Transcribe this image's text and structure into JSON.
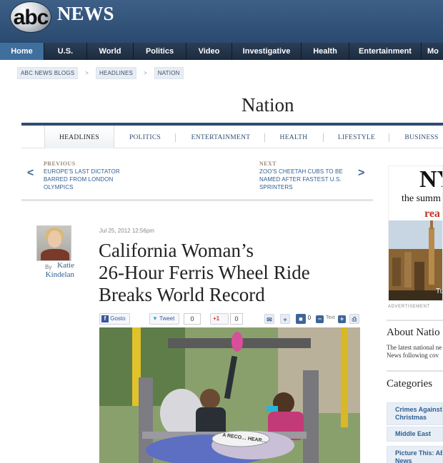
{
  "header": {
    "logo_abc": "abc",
    "logo_news": "NEWS"
  },
  "nav": [
    {
      "label": "Home",
      "active": true
    },
    {
      "label": "U.S."
    },
    {
      "label": "World"
    },
    {
      "label": "Politics"
    },
    {
      "label": "Video"
    },
    {
      "label": "Investigative"
    },
    {
      "label": "Health"
    },
    {
      "label": "Entertainment"
    },
    {
      "label": "Mo"
    }
  ],
  "breadcrumb": [
    "ABC NEWS BLOGS",
    "HEADLINES",
    "NATION"
  ],
  "breadcrumb_sep": ">",
  "section_title": "Nation",
  "section_tabs": [
    "HEADLINES",
    "POLITICS",
    "ENTERTAINMENT",
    "HEALTH",
    "LIFESTYLE",
    "BUSINESS"
  ],
  "prev": {
    "arrow": "<",
    "label": "PREVIOUS",
    "lines": [
      "EUROPE'S LAST DICTATOR",
      "BARRED FROM LONDON",
      "OLYMPICS"
    ]
  },
  "next": {
    "arrow": ">",
    "label": "NEXT",
    "lines": [
      "ZOO'S CHEETAH CUBS TO BE",
      "NAMED AFTER FASTEST U.S.",
      "SPRINTERS"
    ]
  },
  "author": {
    "by": "By",
    "name_line1": "Katie",
    "name_line2": "Kindelan"
  },
  "article": {
    "timestamp": "Jul 25, 2012 12:56pm",
    "headline": [
      "California Woman’s",
      "26-Hour Ferris Wheel Ride",
      "Breaks World Record"
    ]
  },
  "share": {
    "facebook": "Gosto",
    "tweet": "Tweet",
    "tweet_count": "0",
    "gplus": "+1",
    "gplus_count": "0",
    "comment_count": "0",
    "text_label": "Text"
  },
  "photo": {
    "sign_text": "A RECO… HEAR…"
  },
  "ad": {
    "ny": "NY",
    "the": "the summ",
    "rea": "rea",
    "corner": "Tu",
    "label": "ADVERTISEMENT"
  },
  "rail": {
    "about_title": "About Natio",
    "about_text": [
      "The latest national ne",
      "News following cov"
    ],
    "categories_title": "Categories",
    "categories": [
      [
        "Crimes Against",
        "Christmas"
      ],
      [
        "Middle East"
      ],
      [
        "Picture This: AB",
        "News"
      ]
    ]
  },
  "colors": {
    "header": "#2f4d70",
    "nav": "#1c2b3f",
    "nav_active": "#3f6f9d",
    "link": "#2f5e93"
  }
}
